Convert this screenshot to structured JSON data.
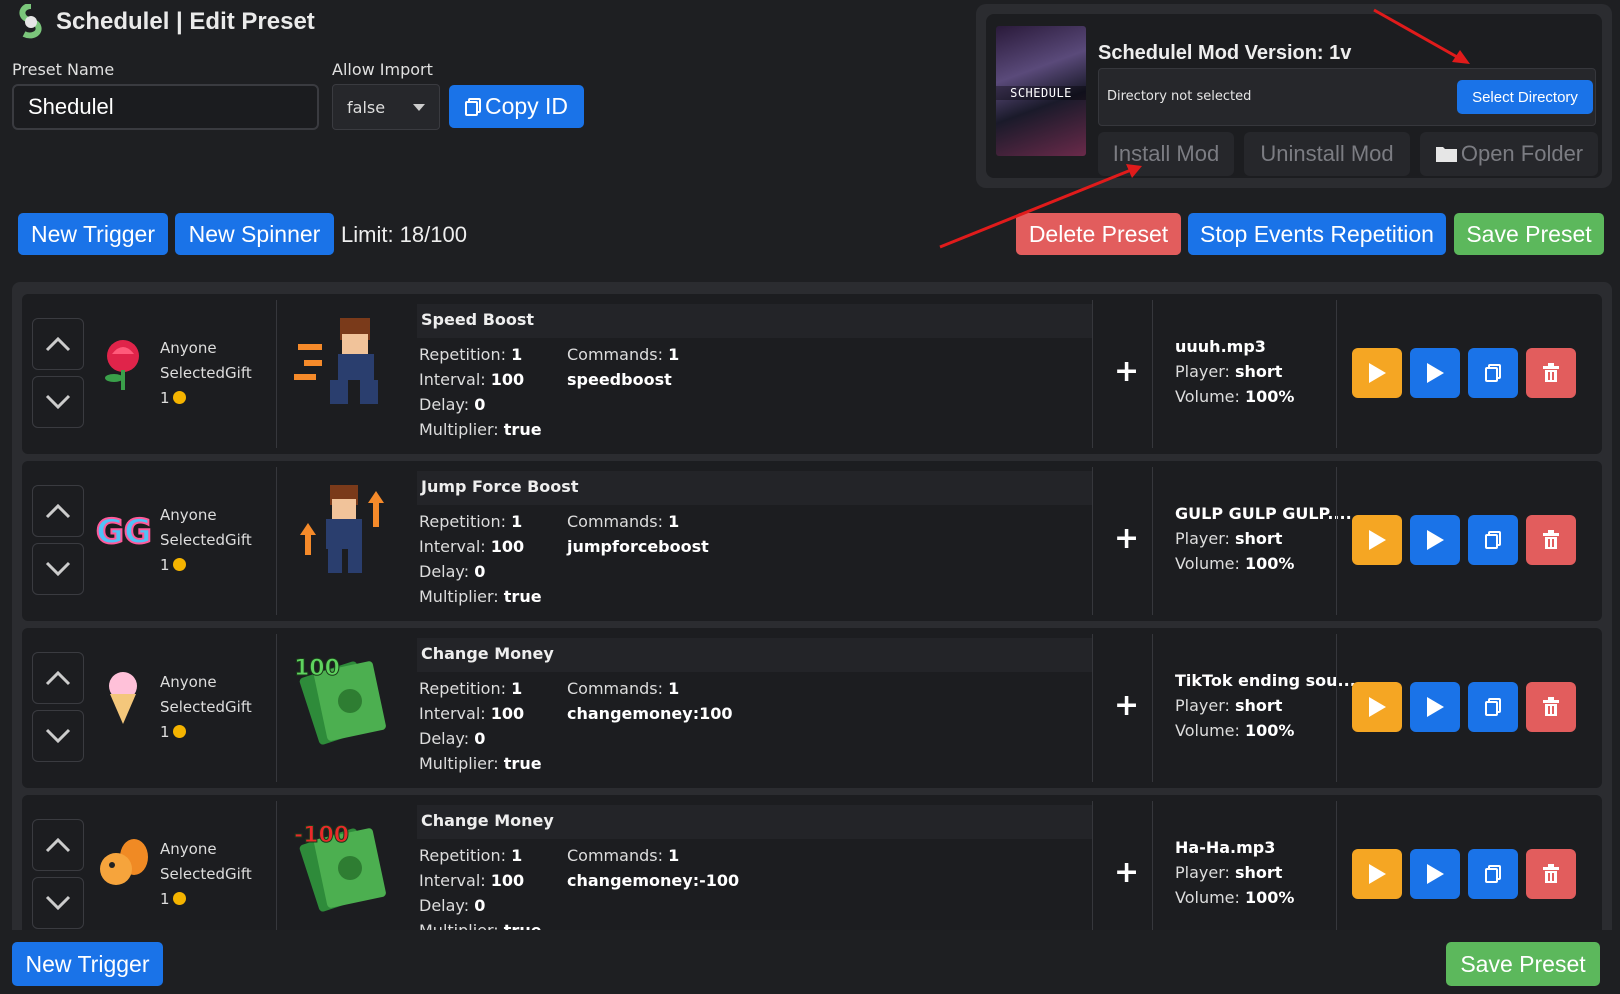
{
  "header": {
    "title": "Schedulel | Edit Preset",
    "preset_name_label": "Preset Name",
    "preset_name_value": "Shedulel",
    "allow_import_label": "Allow Import",
    "allow_import_value": "false",
    "copy_id_label": "Copy ID"
  },
  "mod_panel": {
    "title": "Schedulel Mod Version: 1v",
    "image_caption": "SCHEDULE",
    "directory_status": "Directory not selected",
    "select_directory_label": "Select Directory",
    "install_label": "Install Mod",
    "uninstall_label": "Uninstall Mod",
    "open_folder_label": "Open Folder"
  },
  "toolbar": {
    "new_trigger_label": "New Trigger",
    "new_spinner_label": "New Spinner",
    "limit_text": "Limit: 18/100",
    "delete_preset_label": "Delete Preset",
    "stop_events_label": "Stop Events Repetition",
    "save_preset_label": "Save Preset"
  },
  "triggers": [
    {
      "user": "Anyone",
      "gift_type": "SelectedGift",
      "gift_cost": "1",
      "gift_icon": "rose-icon",
      "action_icon": "speed-boost-icon",
      "title": "Speed Boost",
      "repetition": "1",
      "interval": "100",
      "delay": "0",
      "multiplier": "true",
      "commands_count": "1",
      "command": "speedboost",
      "sound": "uuuh.mp3",
      "player": "short",
      "volume": "100%"
    },
    {
      "user": "Anyone",
      "gift_type": "SelectedGift",
      "gift_cost": "1",
      "gift_icon": "gg-icon",
      "action_icon": "jump-boost-icon",
      "title": "Jump Force Boost",
      "repetition": "1",
      "interval": "100",
      "delay": "0",
      "multiplier": "true",
      "commands_count": "1",
      "command": "jumpforceboost",
      "sound": "GULP GULP GULP....",
      "player": "short",
      "volume": "100%"
    },
    {
      "user": "Anyone",
      "gift_type": "SelectedGift",
      "gift_cost": "1",
      "gift_icon": "ice-cream-icon",
      "action_icon": "money-plus-icon",
      "action_badge": "100",
      "title": "Change Money",
      "repetition": "1",
      "interval": "100",
      "delay": "0",
      "multiplier": "true",
      "commands_count": "1",
      "command": "changemoney:100",
      "sound": "TikTok ending sou...",
      "player": "short",
      "volume": "100%"
    },
    {
      "user": "Anyone",
      "gift_type": "SelectedGift",
      "gift_cost": "1",
      "gift_icon": "squirrel-icon",
      "action_icon": "money-minus-icon",
      "action_badge": "-100",
      "title": "Change Money",
      "repetition": "1",
      "interval": "100",
      "delay": "0",
      "multiplier": "true",
      "commands_count": "1",
      "command": "changemoney:-100",
      "sound": "Ha-Ha.mp3",
      "player": "short",
      "volume": "100%"
    }
  ],
  "labels": {
    "repetition": "Repetition:",
    "interval": "Interval:",
    "delay": "Delay:",
    "multiplier": "Multiplier:",
    "commands": "Commands:",
    "player": "Player:",
    "volume": "Volume:"
  },
  "footer": {
    "new_trigger_label": "New Trigger",
    "save_preset_label": "Save Preset"
  },
  "colors": {
    "accent_blue": "#1a73e8",
    "delete_red": "#e25d5d",
    "save_green": "#5cb85c",
    "play_orange": "#f5a623",
    "annotation_red": "#e01b1b"
  }
}
